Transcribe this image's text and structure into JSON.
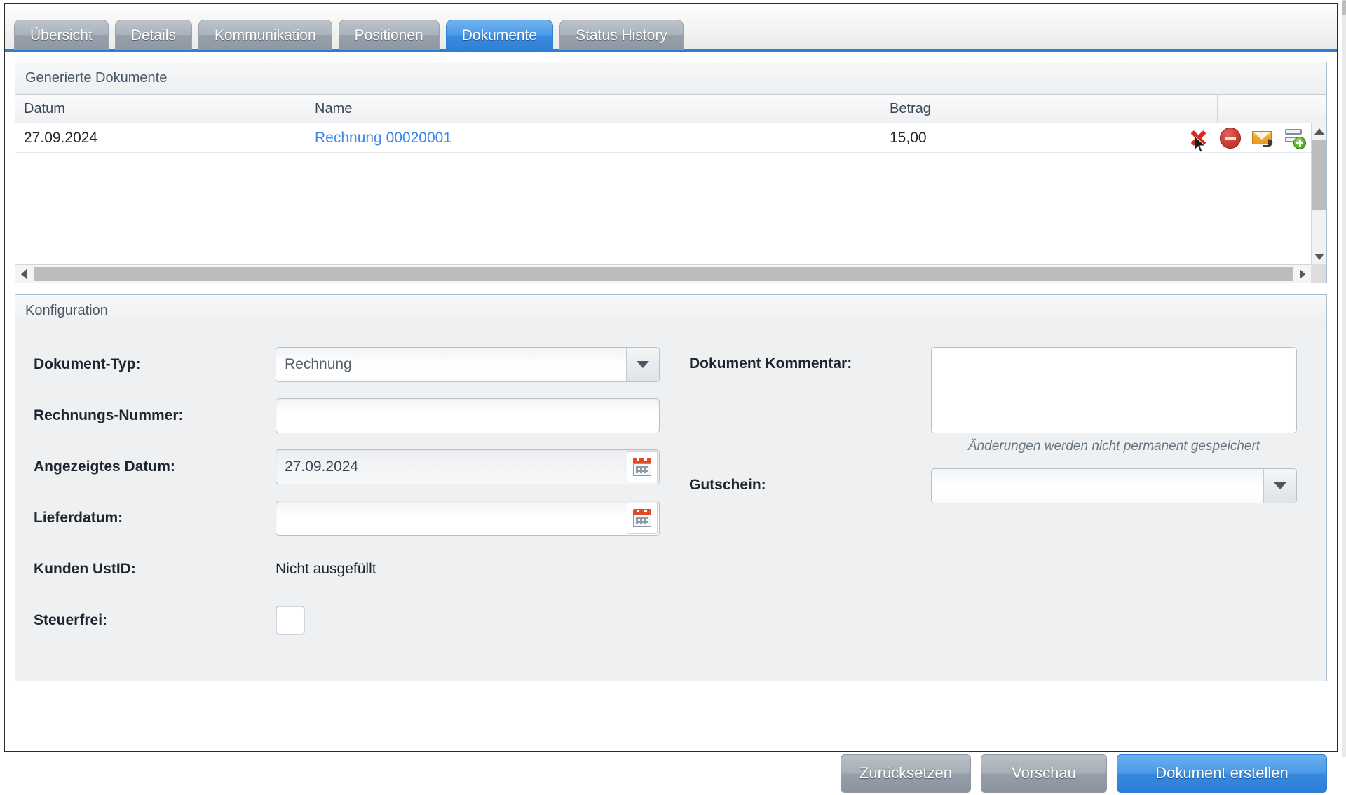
{
  "tabs": [
    {
      "label": "Übersicht",
      "active": false
    },
    {
      "label": "Details",
      "active": false
    },
    {
      "label": "Kommunikation",
      "active": false
    },
    {
      "label": "Positionen",
      "active": false
    },
    {
      "label": "Dokumente",
      "active": true
    },
    {
      "label": "Status History",
      "active": false
    }
  ],
  "documents_panel": {
    "title": "Generierte Dokumente",
    "columns": [
      "Datum",
      "Name",
      "Betrag",
      "",
      ""
    ],
    "rows": [
      {
        "datum": "27.09.2024",
        "name": "Rechnung 00020001",
        "betrag": "15,00",
        "actions": [
          "delete-x-icon",
          "cancel-circle-icon",
          "mail-forward-icon",
          "add-record-icon"
        ]
      }
    ]
  },
  "config_panel": {
    "title": "Konfiguration",
    "left": {
      "dokument_typ_label": "Dokument-Typ:",
      "dokument_typ_value": "Rechnung",
      "rechnungs_nummer_label": "Rechnungs-Nummer:",
      "rechnungs_nummer_value": "",
      "angezeigtes_datum_label": "Angezeigtes Datum:",
      "angezeigtes_datum_value": "27.09.2024",
      "lieferdatum_label": "Lieferdatum:",
      "lieferdatum_value": "",
      "kunden_ustid_label": "Kunden UstID:",
      "kunden_ustid_value": "Nicht ausgefüllt",
      "steuerfrei_label": "Steuerfrei:",
      "steuerfrei_checked": false
    },
    "right": {
      "dokument_kommentar_label": "Dokument Kommentar:",
      "dokument_kommentar_value": "",
      "dokument_kommentar_hint": "Änderungen werden nicht permanent gespeichert",
      "gutschein_label": "Gutschein:",
      "gutschein_value": ""
    }
  },
  "footer": {
    "reset_label": "Zurücksetzen",
    "preview_label": "Vorschau",
    "create_label": "Dokument erstellen"
  },
  "colors": {
    "accent_blue": "#2a7fd4",
    "link_blue": "#3c87e8",
    "tab_inactive": "#97a0aa",
    "panel_bg": "#eef0f2",
    "delete_red": "#d9291c",
    "cancel_red": "#cf4236",
    "mail_orange": "#e79a18",
    "add_green": "#5cba2e",
    "calendar_red": "#e04a28"
  }
}
